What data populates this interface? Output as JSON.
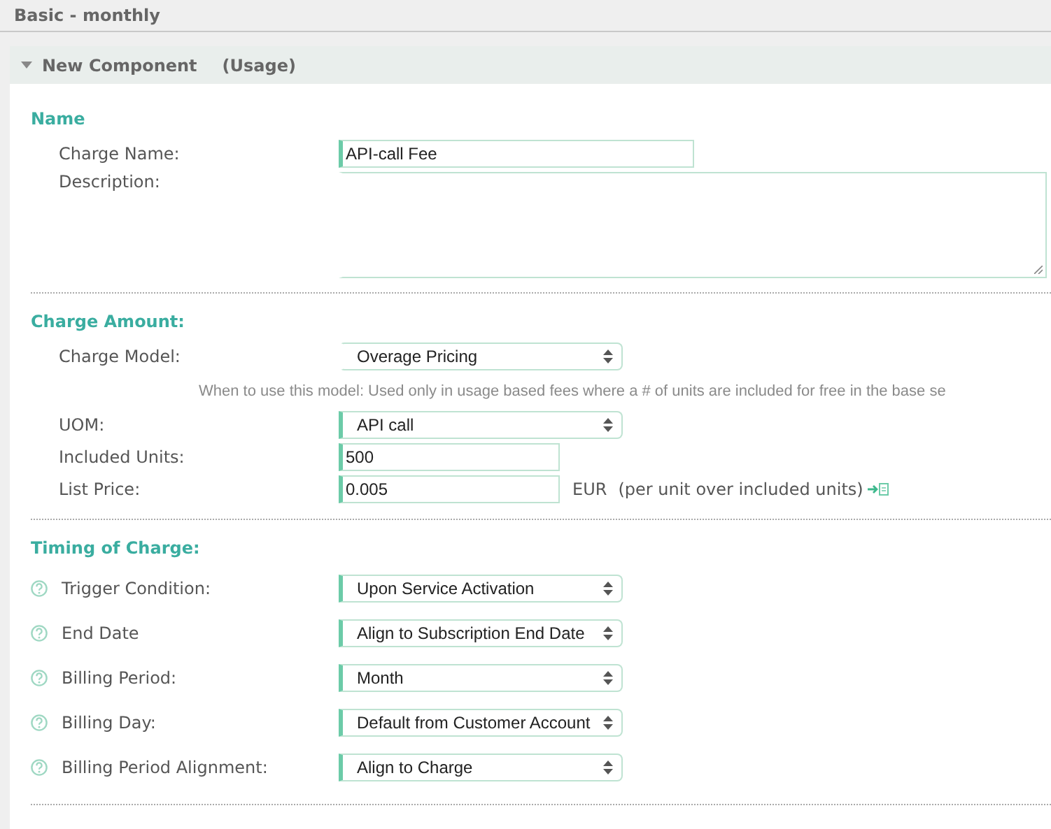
{
  "page_title": "Basic - monthly",
  "component": {
    "expanded": true,
    "title": "New Component",
    "type": "(Usage)"
  },
  "sections": [
    {
      "heading": "Name",
      "rows": [
        {
          "kind": "text",
          "label": "Charge Name:",
          "value": "API-call Fee",
          "required": true
        },
        {
          "kind": "textarea",
          "label": "Description:",
          "value": "",
          "required": false
        }
      ]
    },
    {
      "heading": "Charge Amount:",
      "rows": [
        {
          "kind": "select",
          "label": "Charge Model:",
          "value": "Overage Pricing",
          "required": false
        },
        {
          "kind": "hint",
          "text": "When to use this model: Used only in usage based fees where a # of units are included for free in the base se"
        },
        {
          "kind": "select",
          "label": "UOM:",
          "value": "API call",
          "required": true
        },
        {
          "kind": "text",
          "label": "Included Units:",
          "value": "500",
          "required": true
        },
        {
          "kind": "price",
          "label": "List Price:",
          "value": "0.005",
          "required": true,
          "currency": "EUR",
          "note": "(per unit over included units)"
        }
      ]
    },
    {
      "heading": "Timing of Charge:",
      "rows": [
        {
          "kind": "select",
          "help": true,
          "label": "Trigger Condition:",
          "value": "Upon Service Activation",
          "required": true
        },
        {
          "kind": "select",
          "help": true,
          "label": "End Date",
          "value": "Align to Subscription End Date",
          "required": true
        },
        {
          "kind": "select",
          "help": true,
          "label": "Billing Period:",
          "value": "Month",
          "required": true
        },
        {
          "kind": "select",
          "help": true,
          "label": "Billing Day:",
          "value": "Default from Customer Account",
          "required": true
        },
        {
          "kind": "select",
          "help": true,
          "label": "Billing Period Alignment:",
          "value": "Align to Charge",
          "required": true
        }
      ]
    }
  ]
}
